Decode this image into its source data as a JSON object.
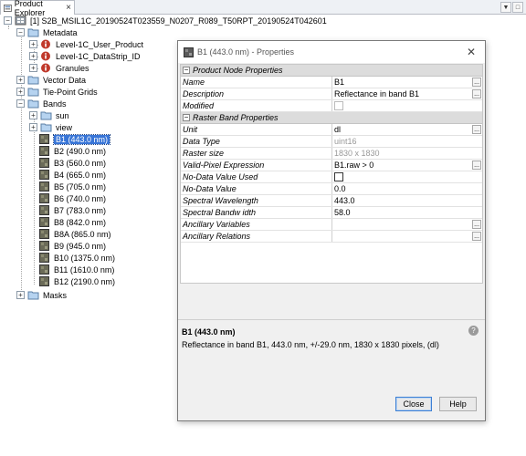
{
  "tabbar": {
    "title": "Product Explorer",
    "close": "×",
    "min": "▼",
    "max": "□"
  },
  "tree": {
    "product": "[1] S2B_MSIL1C_20190524T023559_N0207_R089_T50RPT_20190524T042601",
    "metadata": "Metadata",
    "meta_items": [
      "Level-1C_User_Product",
      "Level-1C_DataStrip_ID",
      "Granules"
    ],
    "vector_data": "Vector Data",
    "tie_point_grids": "Tie-Point Grids",
    "bands": "Bands",
    "band_groups": [
      "sun",
      "view"
    ],
    "band_items": [
      "B1 (443.0 nm)",
      "B2 (490.0 nm)",
      "B3 (560.0 nm)",
      "B4 (665.0 nm)",
      "B5 (705.0 nm)",
      "B6 (740.0 nm)",
      "B7 (783.0 nm)",
      "B8 (842.0 nm)",
      "B8A (865.0 nm)",
      "B9 (945.0 nm)",
      "B10 (1375.0 nm)",
      "B11 (1610.0 nm)",
      "B12 (2190.0 nm)"
    ],
    "masks": "Masks"
  },
  "dialog": {
    "title": "B1 (443.0 nm) - Properties",
    "close": "✕",
    "section1": "Product Node Properties",
    "name_label": "Name",
    "name_value": "B1",
    "description_label": "Description",
    "description_value": "Reflectance in band B1",
    "modified_label": "Modified",
    "section2": "Raster Band Properties",
    "unit_label": "Unit",
    "unit_value": "dl",
    "datatype_label": "Data Type",
    "datatype_value": "uint16",
    "rastersize_label": "Raster size",
    "rastersize_value": "1830 x 1830",
    "validpixel_label": "Valid-Pixel Expression",
    "validpixel_value": "B1.raw > 0",
    "nodataused_label": "No-Data Value Used",
    "nodatavalue_label": "No-Data Value",
    "nodatavalue_value": "0.0",
    "wavelength_label": "Spectral Wavelength",
    "wavelength_value": "443.0",
    "bandwidth_label": "Spectral Bandw idth",
    "bandwidth_value": "58.0",
    "ancillary_vars_label": "Ancillary Variables",
    "ancillary_rel_label": "Ancillary Relations",
    "ellipsis": "...",
    "desc_title": "B1 (443.0 nm)",
    "desc_text": "Reflectance in band B1, 443.0 nm, +/-29.0 nm, 1830 x 1830 pixels, (dl)",
    "help_glyph": "?",
    "close_button": "Close",
    "help_button": "Help"
  }
}
